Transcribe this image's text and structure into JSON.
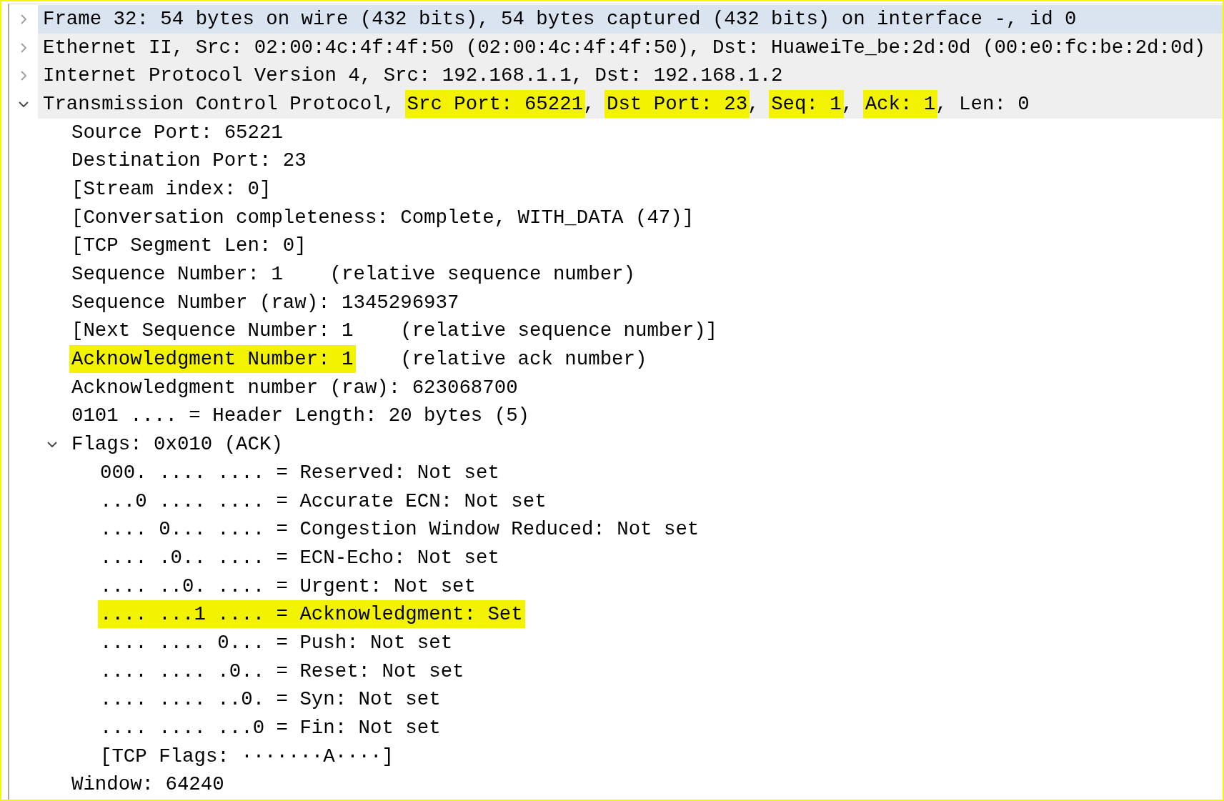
{
  "tree": [
    {
      "parts": [
        {
          "text": "Frame 32: 54 bytes on wire (432 bits), 54 bytes captured (432 bits) on interface -, id 0",
          "highlighted": false
        }
      ],
      "expanded": false,
      "selected": true
    },
    {
      "parts": [
        {
          "text": "Ethernet II, Src: 02:00:4c:4f:4f:50 (02:00:4c:4f:4f:50), Dst: HuaweiTe_be:2d:0d (00:e0:fc:be:2d:0d)",
          "highlighted": false
        }
      ],
      "expanded": false,
      "selected": false
    },
    {
      "parts": [
        {
          "text": "Internet Protocol Version 4, Src: 192.168.1.1, Dst: 192.168.1.2",
          "highlighted": false
        }
      ],
      "expanded": false,
      "selected": false
    },
    {
      "parts": [
        {
          "text": "Transmission Control Protocol, ",
          "highlighted": false
        },
        {
          "text": "Src Port: 65221",
          "highlighted": true
        },
        {
          "text": ", ",
          "highlighted": false
        },
        {
          "text": "Dst Port: 23",
          "highlighted": true
        },
        {
          "text": ", ",
          "highlighted": false
        },
        {
          "text": "Seq: 1",
          "highlighted": true
        },
        {
          "text": ", ",
          "highlighted": false
        },
        {
          "text": "Ack: 1",
          "highlighted": true
        },
        {
          "text": ", Len: 0",
          "highlighted": false
        }
      ],
      "expanded": true,
      "selected": false,
      "children": [
        {
          "parts": [
            {
              "text": "Source Port: 65221",
              "highlighted": false
            }
          ],
          "selected": false
        },
        {
          "parts": [
            {
              "text": "Destination Port: 23",
              "highlighted": false
            }
          ],
          "selected": false
        },
        {
          "parts": [
            {
              "text": "[Stream index: 0]",
              "highlighted": false
            }
          ],
          "selected": false
        },
        {
          "parts": [
            {
              "text": "[Conversation completeness: Complete, WITH_DATA (47)]",
              "highlighted": false
            }
          ],
          "selected": false
        },
        {
          "parts": [
            {
              "text": "[TCP Segment Len: 0]",
              "highlighted": false
            }
          ],
          "selected": false
        },
        {
          "parts": [
            {
              "text": "Sequence Number: 1    (relative sequence number)",
              "highlighted": false
            }
          ],
          "selected": false
        },
        {
          "parts": [
            {
              "text": "Sequence Number (raw): 1345296937",
              "highlighted": false
            }
          ],
          "selected": false
        },
        {
          "parts": [
            {
              "text": "[Next Sequence Number: 1    (relative sequence number)]",
              "highlighted": false
            }
          ],
          "selected": false
        },
        {
          "parts": [
            {
              "text": "Acknowledgment Number: 1",
              "highlighted": true
            },
            {
              "text": "    (relative ack number)",
              "highlighted": false
            }
          ],
          "selected": false
        },
        {
          "parts": [
            {
              "text": "Acknowledgment number (raw): 623068700",
              "highlighted": false
            }
          ],
          "selected": false
        },
        {
          "parts": [
            {
              "text": "0101 .... = Header Length: 20 bytes (5)",
              "highlighted": false
            }
          ],
          "selected": false
        },
        {
          "parts": [
            {
              "text": "Flags: 0x010 (ACK)",
              "highlighted": false
            }
          ],
          "expanded": true,
          "selected": false,
          "children": [
            {
              "parts": [
                {
                  "text": "000. .... .... = Reserved: Not set",
                  "highlighted": false
                }
              ],
              "selected": false
            },
            {
              "parts": [
                {
                  "text": "...0 .... .... = Accurate ECN: Not set",
                  "highlighted": false
                }
              ],
              "selected": false
            },
            {
              "parts": [
                {
                  "text": ".... 0... .... = Congestion Window Reduced: Not set",
                  "highlighted": false
                }
              ],
              "selected": false
            },
            {
              "parts": [
                {
                  "text": ".... .0.. .... = ECN-Echo: Not set",
                  "highlighted": false
                }
              ],
              "selected": false
            },
            {
              "parts": [
                {
                  "text": ".... ..0. .... = Urgent: Not set",
                  "highlighted": false
                }
              ],
              "selected": false
            },
            {
              "parts": [
                {
                  "text": ".... ...1 .... = Acknowledgment: Set",
                  "highlighted": true
                }
              ],
              "selected": false
            },
            {
              "parts": [
                {
                  "text": ".... .... 0... = Push: Not set",
                  "highlighted": false
                }
              ],
              "selected": false
            },
            {
              "parts": [
                {
                  "text": ".... .... .0.. = Reset: Not set",
                  "highlighted": false
                }
              ],
              "selected": false
            },
            {
              "parts": [
                {
                  "text": ".... .... ..0. = Syn: Not set",
                  "highlighted": false
                }
              ],
              "selected": false
            },
            {
              "parts": [
                {
                  "text": ".... .... ...0 = Fin: Not set",
                  "highlighted": false
                }
              ],
              "selected": false
            },
            {
              "parts": [
                {
                  "text": "[TCP Flags: ·······A····]",
                  "highlighted": false
                }
              ],
              "selected": false
            }
          ]
        },
        {
          "parts": [
            {
              "text": "Window: 64240",
              "highlighted": false
            }
          ],
          "selected": false
        }
      ]
    }
  ]
}
